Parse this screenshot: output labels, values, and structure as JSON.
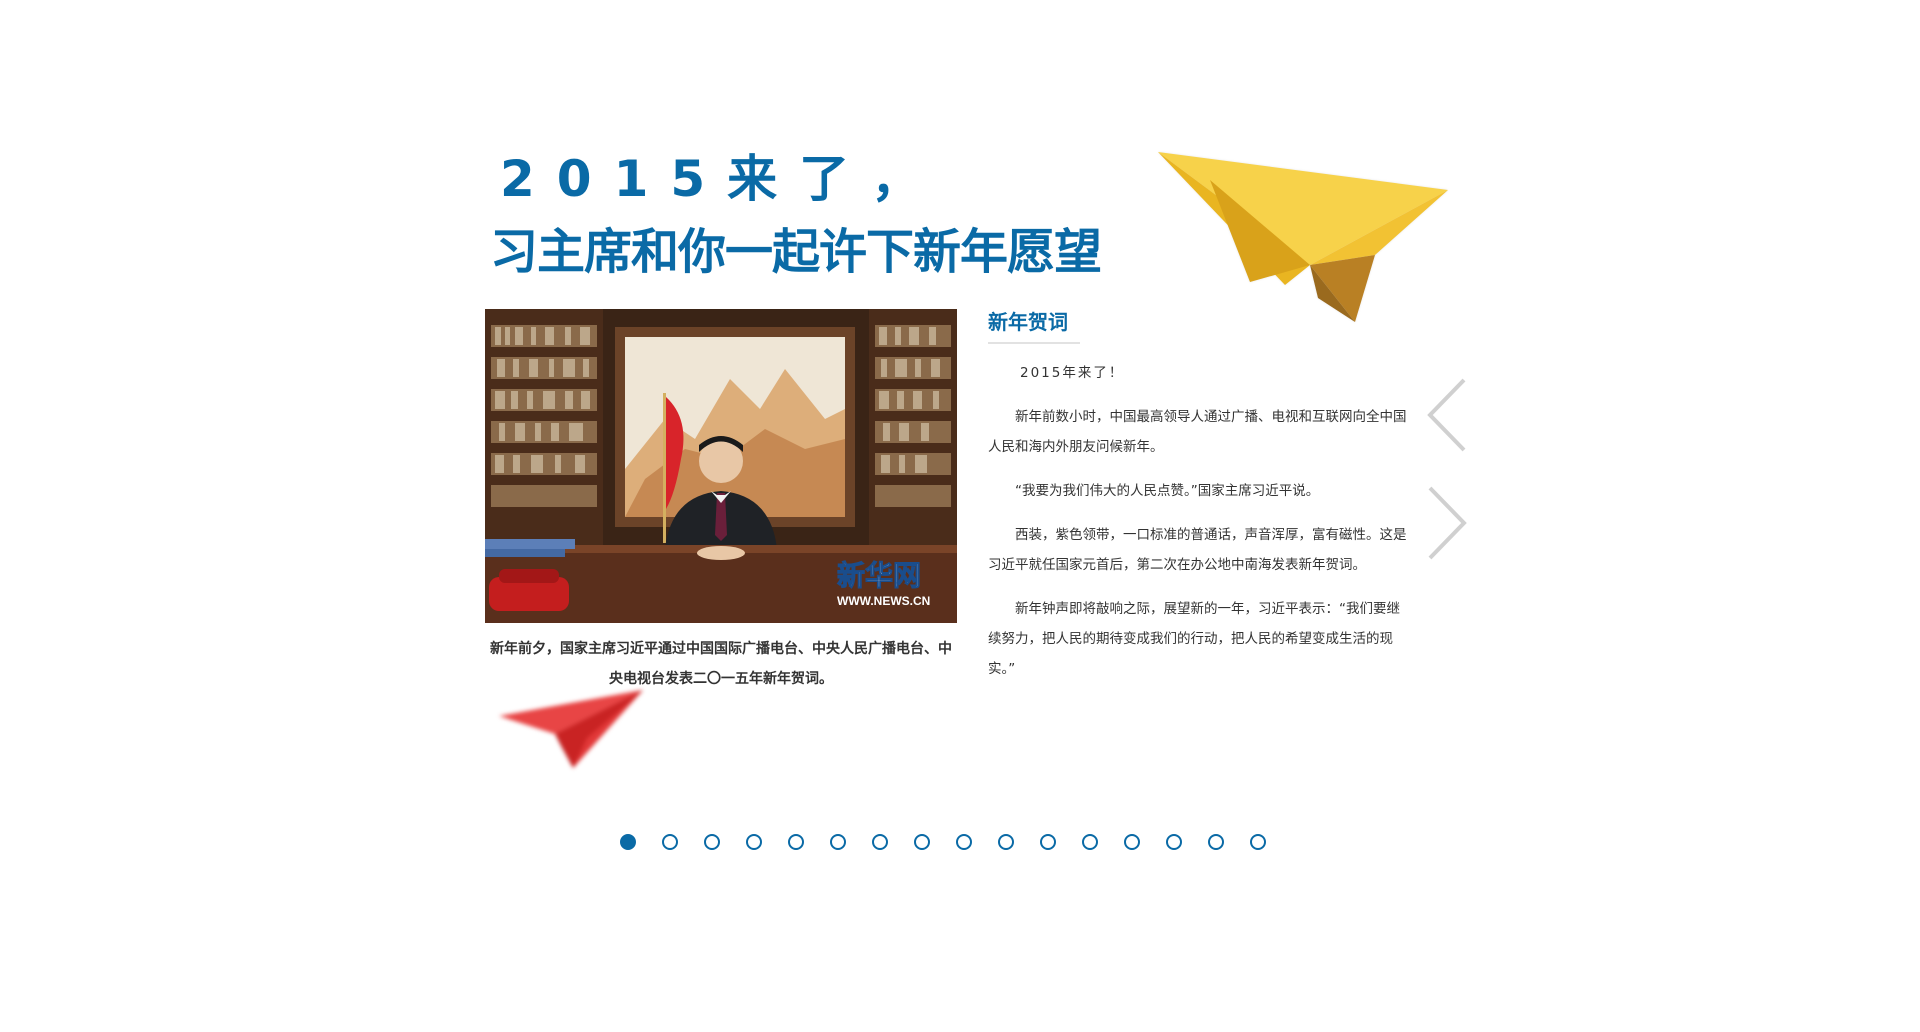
{
  "headline": {
    "line1": "2015来了，",
    "line2": "习主席和你一起许下新年愿望"
  },
  "photo": {
    "watermark_logo": "新华网",
    "watermark_url": "WWW.NEWS.CN"
  },
  "caption": "新年前夕，国家主席习近平通过中国国际广播电台、中央人民广播电台、中央电视台发表二〇一五年新年贺词。",
  "article": {
    "title": "新年贺词",
    "paragraphs": [
      "2015年来了！",
      "新年前数小时，中国最高领导人通过广播、电视和互联网向全中国人民和海内外朋友问候新年。",
      "“我要为我们伟大的人民点赞。”国家主席习近平说。",
      "西装，紫色领带，一口标准的普通话，声音浑厚，富有磁性。这是习近平就任国家元首后，第二次在办公地中南海发表新年贺词。",
      "新年钟声即将敲响之际，展望新的一年，习近平表示：“我们要继续努力，把人民的期待变成我们的行动，把人民的希望变成生活的现实。”"
    ]
  },
  "navigation": {
    "prev_icon": "chevron-left-icon",
    "next_icon": "chevron-right-icon"
  },
  "pagination": {
    "total": 16,
    "active_index": 0
  },
  "colors": {
    "accent": "#0a6aa6",
    "text": "#333333",
    "plane_yellow": "#f5c12e",
    "plane_red": "#d8242a",
    "arrow_gray": "#d0d0d0"
  }
}
